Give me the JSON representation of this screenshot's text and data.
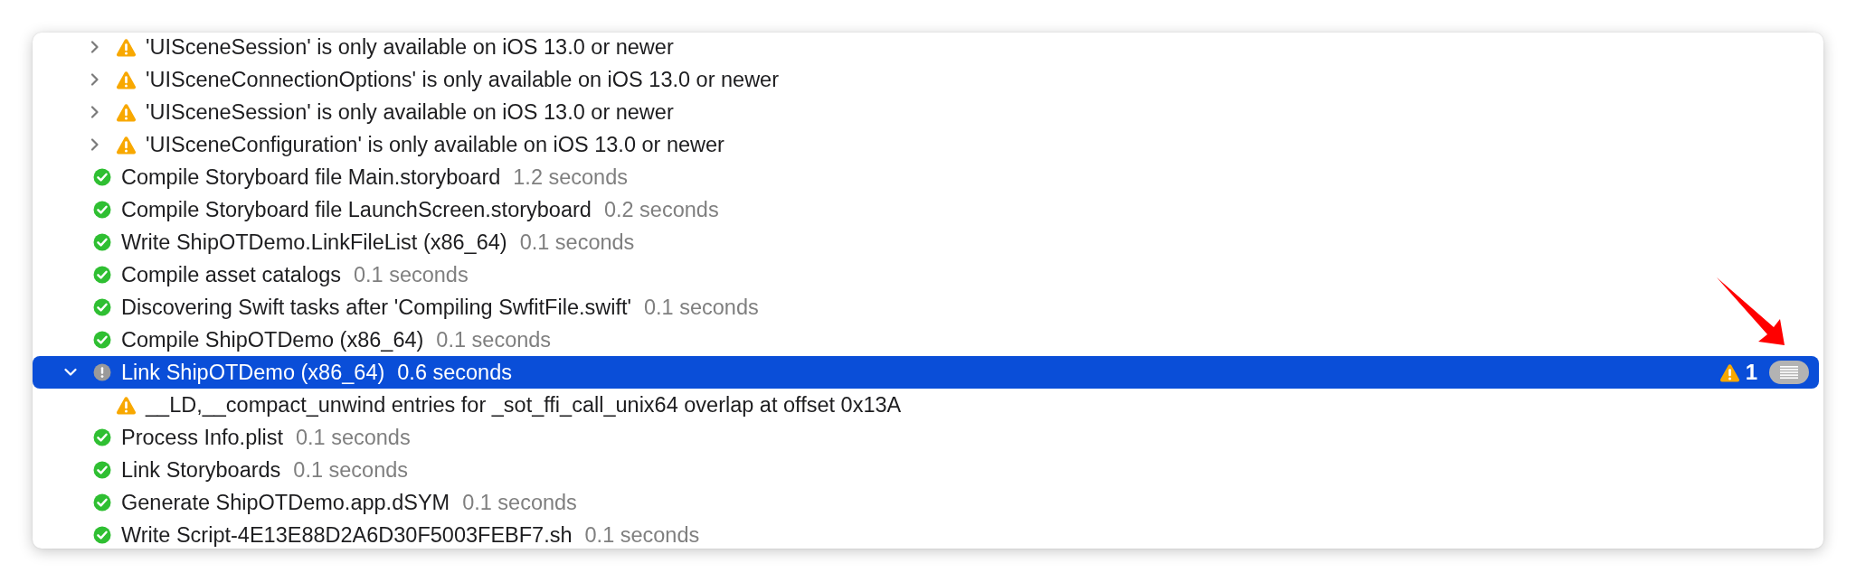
{
  "build_log": {
    "continued_issues": [
      {
        "message": "'UISceneSession' is only available on iOS 13.0 or newer",
        "expanded": false,
        "selected": false
      },
      {
        "message": "'UISceneConnectionOptions' is only available on iOS 13.0 or newer",
        "expanded": false,
        "selected": false
      },
      {
        "message": "'UISceneSession' is only available on iOS 13.0 or newer",
        "expanded": false,
        "selected": false
      },
      {
        "message": "'UISceneConfiguration' is only available on iOS 13.0 or newer",
        "expanded": false,
        "selected": false
      }
    ],
    "steps": [
      {
        "kind": "success",
        "title": "Compile Storyboard file Main.storyboard",
        "duration": "1.2 seconds",
        "selected": false
      },
      {
        "kind": "success",
        "title": "Compile Storyboard file LaunchScreen.storyboard",
        "duration": "0.2 seconds",
        "selected": false
      },
      {
        "kind": "success",
        "title": "Write ShipOTDemo.LinkFileList (x86_64)",
        "duration": "0.1 seconds",
        "selected": false
      },
      {
        "kind": "success",
        "title": "Compile asset catalogs",
        "duration": "0.1 seconds",
        "selected": false
      },
      {
        "kind": "success",
        "title": "Discovering Swift tasks after 'Compiling SwfitFile.swift'",
        "duration": "0.1 seconds",
        "selected": false
      },
      {
        "kind": "success",
        "title": "Compile ShipOTDemo (x86_64)",
        "duration": "0.1 seconds",
        "selected": false
      },
      {
        "kind": "alert",
        "title": "Link ShipOTDemo (x86_64)",
        "duration": "0.6 seconds",
        "selected": true,
        "expanded": true,
        "issue_count": "1",
        "children": [
          {
            "message": "__LD,__compact_unwind entries for _sot_ffi_call_unix64 overlap at offset 0x13A",
            "selected": false
          }
        ]
      },
      {
        "kind": "success",
        "title": "Process Info.plist",
        "duration": "0.1 seconds",
        "selected": false
      },
      {
        "kind": "success",
        "title": "Link Storyboards",
        "duration": "0.1 seconds",
        "selected": false
      },
      {
        "kind": "success",
        "title": "Generate ShipOTDemo.app.dSYM",
        "duration": "0.1 seconds",
        "selected": false
      },
      {
        "kind": "success",
        "title": "Write Script-4E13E88D2A6D30F5003FEBF7.sh",
        "duration": "0.1 seconds",
        "selected": false
      }
    ]
  }
}
